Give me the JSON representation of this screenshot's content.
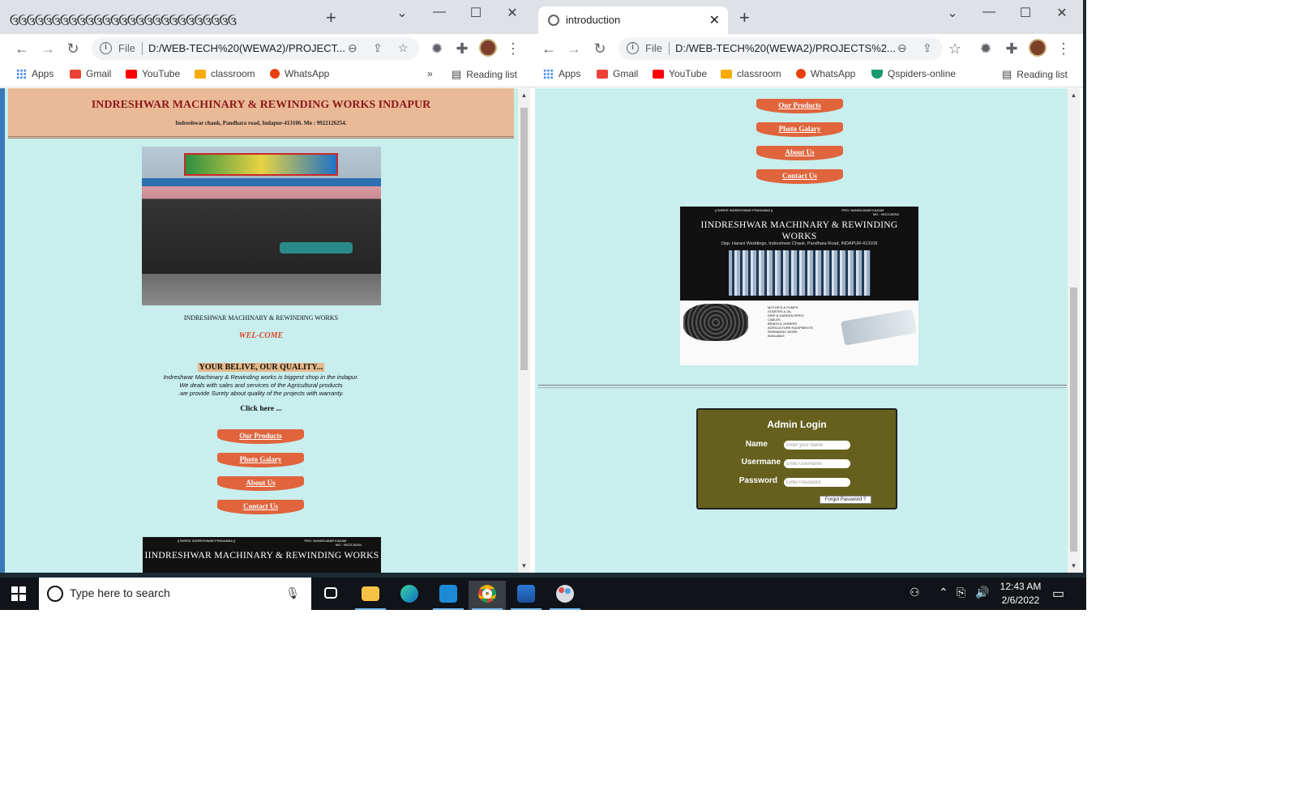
{
  "left_window": {
    "tab_strip_text": "ઉઉઉઉઉઉઉઉઉઉઉઉઉઉઉઉઉઉઉઉઉઉઉઉઉઉઉ",
    "new_tab": "+",
    "controls": {
      "dropdown": "⌄",
      "minimize": "—",
      "maximize": "☐",
      "close": "✕"
    },
    "address": {
      "scheme": "File",
      "url": "D:/WEB-TECH%20(WEWA2)/PROJECT..."
    },
    "bookmarks": [
      {
        "label": "Apps",
        "icon": "apps-grid-icon"
      },
      {
        "label": "Gmail",
        "icon": "gmail-icon",
        "color": "#ea4335"
      },
      {
        "label": "YouTube",
        "icon": "youtube-icon",
        "color": "#ff0000"
      },
      {
        "label": "classroom",
        "icon": "classroom-icon",
        "color": "#188038"
      },
      {
        "label": "WhatsApp",
        "icon": "whatsapp-icon",
        "color": "#e8400c"
      }
    ],
    "more_bookmarks": "»",
    "reading_list": "Reading list"
  },
  "right_window": {
    "tab_title": "introduction",
    "new_tab": "+",
    "controls": {
      "dropdown": "⌄",
      "minimize": "—",
      "maximize": "☐",
      "close": "✕"
    },
    "address": {
      "scheme": "File",
      "url": "D:/WEB-TECH%20(WEWA2)/PROJECTS%2..."
    },
    "bookmarks": [
      {
        "label": "Apps",
        "icon": "apps-grid-icon"
      },
      {
        "label": "Gmail",
        "icon": "gmail-icon",
        "color": "#ea4335"
      },
      {
        "label": "YouTube",
        "icon": "youtube-icon",
        "color": "#ff0000"
      },
      {
        "label": "classroom",
        "icon": "classroom-icon",
        "color": "#188038"
      },
      {
        "label": "WhatsApp",
        "icon": "whatsapp-icon",
        "color": "#e8400c"
      },
      {
        "label": "Qspiders-online",
        "icon": "qspiders-icon",
        "color": "#1a9a6c"
      }
    ],
    "reading_list": "Reading list"
  },
  "site": {
    "header_title": "INDRESHWAR MACHINARY & REWINDING WORKS INDAPUR",
    "header_address": "Indreshwar chauk, Pandhara road, Indapur-413106. Mo : 9922126254.",
    "shop_name": "INDRESHWAR MACHINARY & REWINDING WORKS",
    "welcome": "WEL-COME",
    "slogan": "YOUR BELIVE, OUR QUALITY...",
    "description": [
      "Indreshwar Machinary & Rewinding works is biggest shop in the indapur.",
      "We deals with sales and services of the Agricultural products",
      ".we provide Surety about quality of the projects with warranty."
    ],
    "click_here": "Click here ...",
    "nav": {
      "products": "Our Products",
      "gallery": "Photo Galary",
      "about": "About Us",
      "contact": "Contact Us"
    },
    "poster": {
      "top_left": "|| SHREE INDRESHWAR PRASANNA ||",
      "top_right": "PRO. NANDKUMAR KADAM",
      "top_right_mobile": "MO : 9922126254",
      "title": "IINDRESHWAR MACHINARY & REWINDING WORKS",
      "subtitle": "Opp. Harani Weddings, Indreshwar Chauk, Pandhara Road, INDAPUR-413106",
      "list": [
        "MOTOR'S & PUMPS",
        "STARTER & OIL",
        "DRIP & GARDEN PIPES",
        "CABLES",
        "BENDS & JOINERS",
        "AGRICULTURE EQUIPMENTS",
        "REWINDING WORK",
        "AVAILABLE"
      ]
    },
    "admin": {
      "title": "Admin Login",
      "name_label": "Name",
      "name_placeholder": "Enter your Name",
      "username_label": "Usermane",
      "username_placeholder": "Enter Username",
      "password_label": "Password",
      "password_placeholder": "Enter Password",
      "forgot": "Forgot Password ?"
    }
  },
  "taskbar": {
    "search_placeholder": "Type here to search",
    "time": "12:43 AM",
    "date": "2/6/2022",
    "apps": [
      "task-view-icon",
      "file-explorer-icon",
      "edge-icon",
      "vscode-icon",
      "chrome-icon",
      "photos-icon",
      "paint-icon"
    ]
  }
}
